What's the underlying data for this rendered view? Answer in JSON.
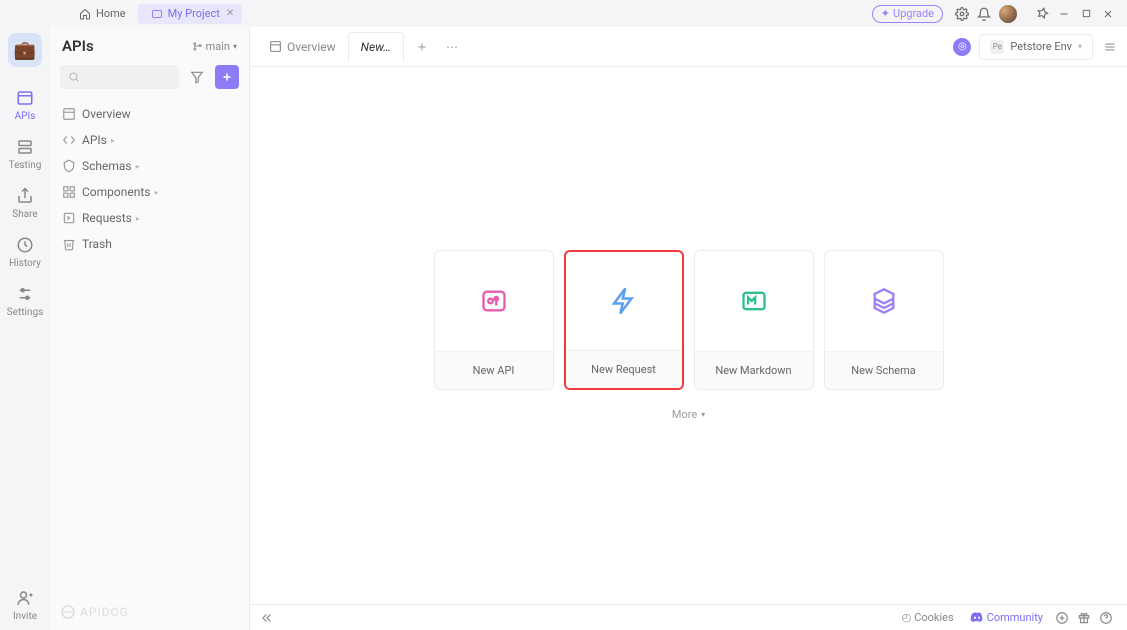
{
  "titlebar": {
    "home_label": "Home",
    "project_label": "My Project",
    "upgrade_label": "Upgrade"
  },
  "nav": {
    "items": [
      {
        "label": "APIs"
      },
      {
        "label": "Testing"
      },
      {
        "label": "Share"
      },
      {
        "label": "History"
      },
      {
        "label": "Settings"
      }
    ],
    "invite_label": "Invite"
  },
  "sidebar": {
    "title": "APIs",
    "branch": "main",
    "items": [
      {
        "label": "Overview"
      },
      {
        "label": "APIs"
      },
      {
        "label": "Schemas"
      },
      {
        "label": "Components"
      },
      {
        "label": "Requests"
      },
      {
        "label": "Trash"
      }
    ],
    "branding": "APIDOG"
  },
  "tabs": {
    "overview_label": "Overview",
    "new_label": "New…",
    "env_label": "Petstore Env",
    "env_tag": "Pe"
  },
  "cards": [
    {
      "label": "New API"
    },
    {
      "label": "New Request"
    },
    {
      "label": "New Markdown"
    },
    {
      "label": "New Schema"
    }
  ],
  "more_label": "More",
  "status": {
    "cookies_label": "Cookies",
    "community_label": "Community"
  }
}
